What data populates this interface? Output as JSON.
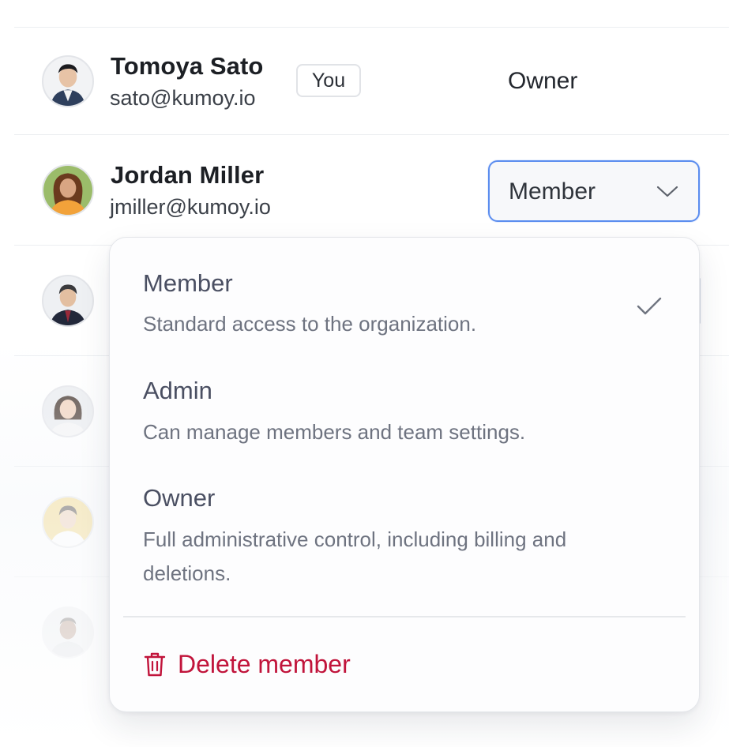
{
  "members": [
    {
      "name": "Tomoya Sato",
      "email": "sato@kumoy.io",
      "badge": "You",
      "role": "Owner"
    },
    {
      "name": "Jordan Miller",
      "email": "jmiller@kumoy.io",
      "role": "Member"
    }
  ],
  "role_menu": {
    "selected": "Member",
    "options": [
      {
        "title": "Member",
        "description": "Standard access to the organization."
      },
      {
        "title": "Admin",
        "description": "Can manage members and team settings."
      },
      {
        "title": "Owner",
        "description": "Full administrative control, including billing and deletions."
      }
    ],
    "delete_label": "Delete member"
  },
  "colors": {
    "accent": "#5b8def",
    "danger": "#c1143b"
  },
  "icons": {
    "check": "check-icon",
    "chevron": "chevron-down-icon",
    "trash": "trash-icon"
  }
}
